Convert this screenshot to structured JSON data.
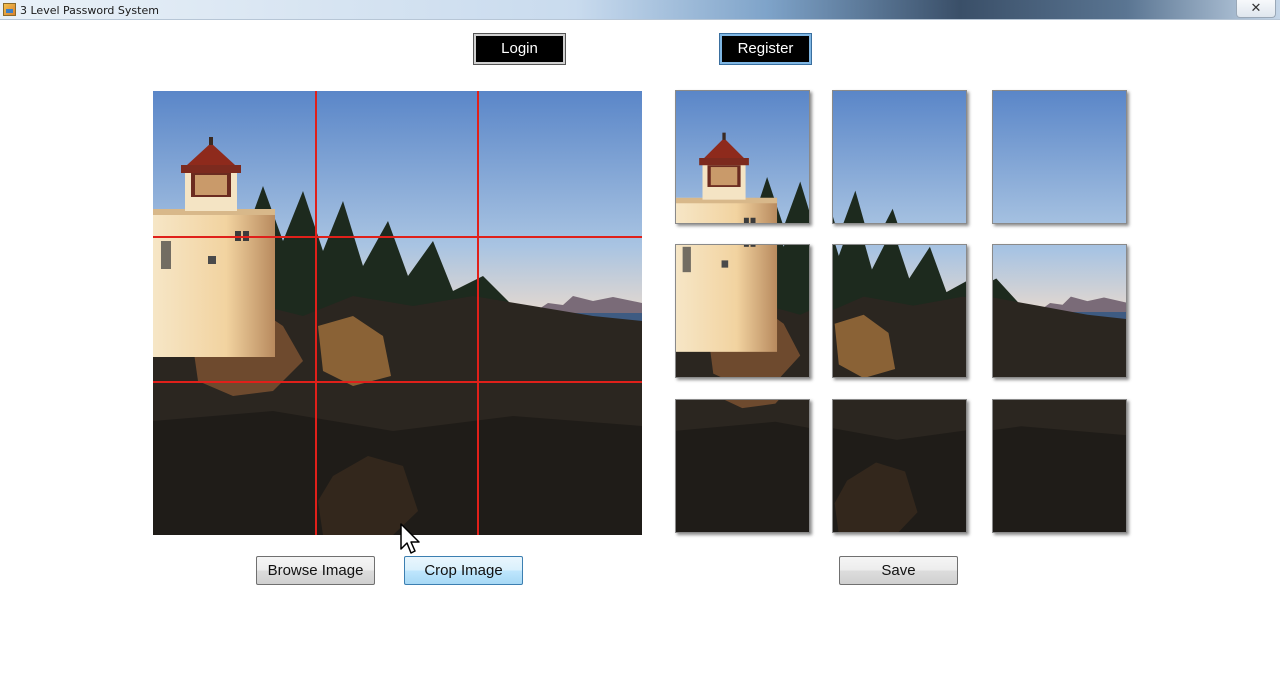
{
  "window": {
    "title": "3 Level Password System",
    "close_glyph": "✕"
  },
  "nav": {
    "login_label": "Login",
    "register_label": "Register"
  },
  "image_panel": {
    "image_icon": "lighthouse-photo",
    "grid": {
      "rows": 3,
      "cols": 3,
      "line_color": "#e0201a"
    }
  },
  "crop_tiles": {
    "rows": 3,
    "cols": 3,
    "tile_names": [
      "tile-1",
      "tile-2",
      "tile-3",
      "tile-4",
      "tile-5",
      "tile-6",
      "tile-7",
      "tile-8",
      "tile-9"
    ]
  },
  "actions": {
    "browse_label": "Browse Image",
    "crop_label": "Crop Image",
    "save_label": "Save"
  },
  "colors": {
    "button_dark": "#000000",
    "accent_blue": "#3c7fb1",
    "grid_red": "#e0201a"
  }
}
